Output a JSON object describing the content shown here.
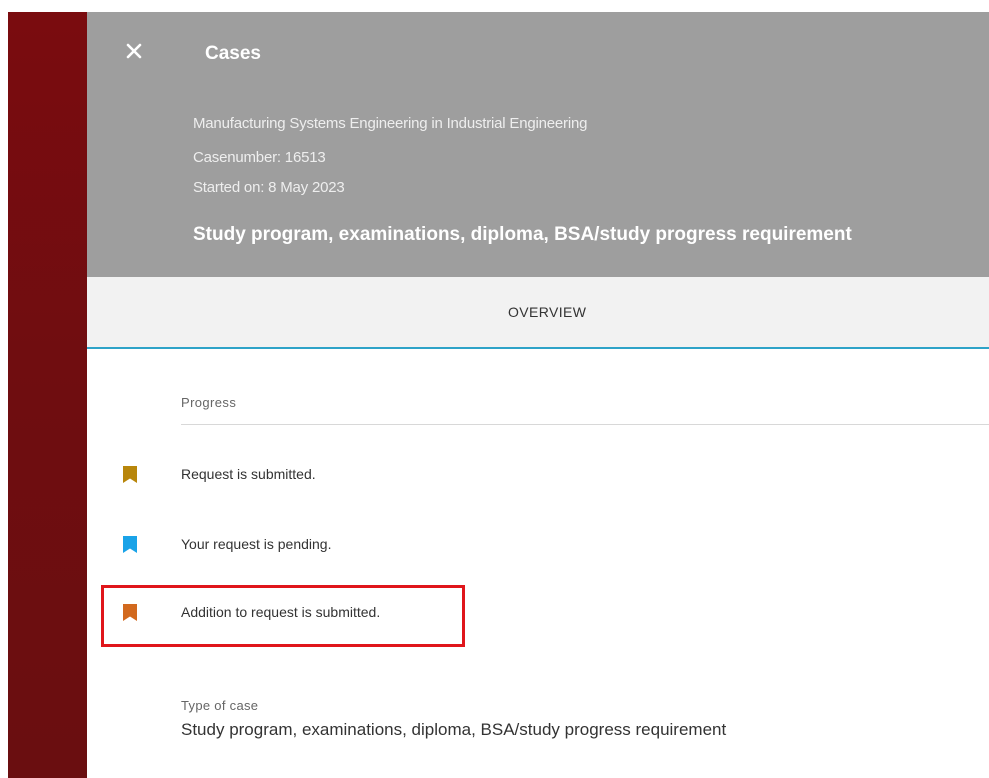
{
  "colors": {
    "backdrop": "#7a0c0f",
    "header_bg": "#9e9e9e",
    "tab_bg": "#f2f2f2",
    "tab_indicator": "#2ea3c8",
    "highlight": "#e0161b"
  },
  "header": {
    "close_icon": "close-icon",
    "title": "Cases",
    "program": "Manufacturing Systems Engineering in Industrial Engineering",
    "case_number": "Casenumber: 16513",
    "started_on": "Started on: 8 May 2023",
    "subject": "Study program, examinations, diploma, BSA/study progress requirement"
  },
  "tabs": [
    {
      "label": "OVERVIEW",
      "active": true
    }
  ],
  "progress": {
    "label": "Progress",
    "items": [
      {
        "text": "Request is submitted.",
        "icon": "bookmark-icon",
        "color": "#b8860b"
      },
      {
        "text": "Your request is pending.",
        "icon": "bookmark-icon",
        "color": "#1aa3e8"
      },
      {
        "text": "Addition to request is submitted.",
        "icon": "bookmark-icon",
        "color": "#d2691e",
        "highlighted": true
      }
    ]
  },
  "case_type": {
    "label": "Type of case",
    "value": "Study program, examinations, diploma, BSA/study progress requirement"
  }
}
